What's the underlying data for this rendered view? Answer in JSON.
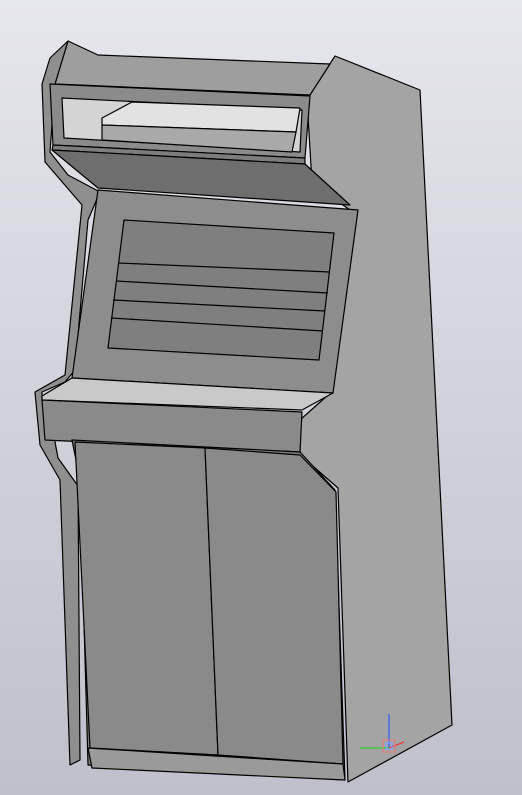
{
  "scene": {
    "model": "arcade-cabinet",
    "view": "isometric-shaded-with-edges",
    "colors": {
      "background_top": "#e6e7ec",
      "background_bottom": "#bfc0cb",
      "side_panel": "#a3a3a3",
      "front_dark": "#8c8c8c",
      "door": "#8a8a8a",
      "top_light": "#c8c8c8",
      "marquee_inner": "#d7d7d7",
      "edge": "#000000"
    },
    "axes_indicator": {
      "x_color": "#ff2a2a",
      "y_color": "#2ad02a",
      "z_color": "#2a5cff",
      "icon": "triad-icon"
    }
  }
}
